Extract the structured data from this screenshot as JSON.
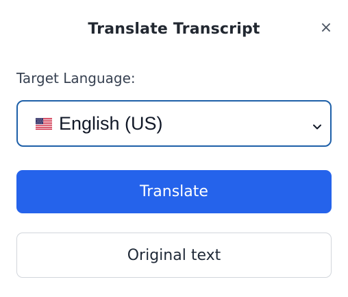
{
  "dialog": {
    "title": "Translate Transcript",
    "close_icon": "close-icon",
    "close_label": "×"
  },
  "language": {
    "label": "Target Language:",
    "selected": "English (US)",
    "flag_icon": "us-flag-icon",
    "chevron_icon": "chevron-down-icon"
  },
  "actions": {
    "translate_label": "Translate",
    "original_label": "Original text"
  },
  "colors": {
    "primary": "#2563eb",
    "select_border": "#1d5fa8",
    "secondary_border": "#d1d5db"
  }
}
